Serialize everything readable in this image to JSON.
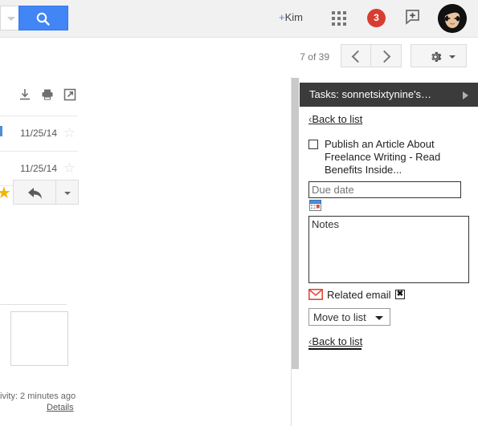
{
  "topbar": {
    "profile_name_plus": "+",
    "profile_name": "Kim",
    "apps_icon": "apps-grid-icon",
    "notifications_count": "3",
    "share_icon": "share-post-icon",
    "avatar_icon": "user-avatar",
    "search_icon": "search-icon",
    "search_dropdown_icon": "chevron-down-icon"
  },
  "pager": {
    "current": "7",
    "of_word": "of",
    "total": "39",
    "count_text": "7 of 39",
    "prev_icon": "chevron-left-icon",
    "next_icon": "chevron-right-icon",
    "settings_icon": "gear-icon"
  },
  "mail": {
    "toolbar_icons": [
      "download-icon",
      "print-icon",
      "popout-icon"
    ],
    "rows": [
      {
        "date": "11/25/14",
        "star_icon": "star-outline-icon"
      },
      {
        "date": "11/25/14",
        "star_icon": "star-outline-icon"
      }
    ],
    "starred_icon": "star-filled-icon",
    "reply_icon": "reply-arrow-icon",
    "reply_more_icon": "chevron-down-icon",
    "footer_activity": "ivity: 2 minutes ago",
    "footer_details": "Details"
  },
  "tasks": {
    "header_title": "Tasks: sonnetsixtynine's…",
    "header_expand_icon": "triangle-right-icon",
    "back_to_list_top": "Back to list",
    "back_to_list_bottom": "Back to list",
    "back_chevron": "‹",
    "task": {
      "checkbox_icon": "checkbox-unchecked-icon",
      "text": "Publish an Article About Freelance Writing - Read Benefits Inside..."
    },
    "due_date_placeholder": "Due date",
    "due_date_value": "",
    "calendar_icon": "calendar-picker-icon",
    "notes_value": "Notes",
    "notes_placeholder": "Notes",
    "related_email_label": "Related email",
    "gmail_icon": "gmail-envelope-icon",
    "related_email_remove_icon": "close-x-icon",
    "related_email_remove_label": "✖",
    "move_to_list_label": "Move to list",
    "move_to_list_caret_icon": "triangle-down-icon"
  },
  "colors": {
    "search_blue": "#4285f4",
    "badge_red": "#d73d32",
    "tasks_header_dark": "#3b3b3b",
    "topbar_gray": "#f1f1f1",
    "star_gold": "#f4b400",
    "gmail_red": "#e04a3f"
  }
}
